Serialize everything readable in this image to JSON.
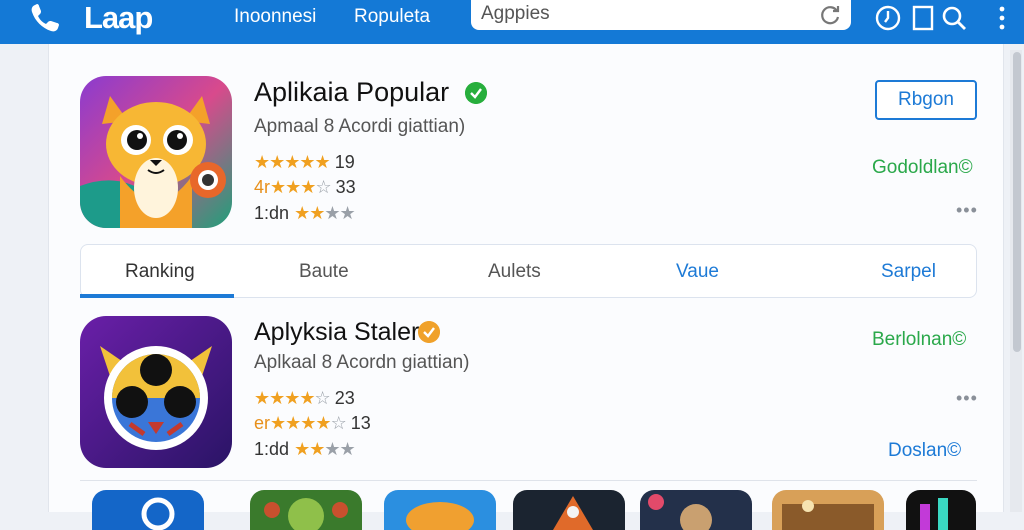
{
  "header": {
    "logo": "Laap",
    "nav": [
      "Inoonnesi",
      "Ropuleta"
    ],
    "search_value": "Agppies",
    "icons": [
      "phone-icon",
      "refresh-icon",
      "clock-icon",
      "square-icon",
      "search-icon",
      "more-vertical-icon"
    ]
  },
  "apps": [
    {
      "title": "Aplikaia Popular",
      "subtitle": "Apmaal 8 Acordi giattian)",
      "ratings": [
        {
          "prefix": "",
          "count": "19",
          "stars": 5
        },
        {
          "prefix": "4r",
          "count": "33",
          "stars": 4
        },
        {
          "prefix": "1:dn",
          "count": "",
          "stars": 3
        }
      ],
      "button": "Rbgon",
      "link": "Godoldlan©",
      "badge_color": "#27ae3c"
    },
    {
      "title": "Aplyksia Staler",
      "subtitle": "Aplkaal 8 Acordn giattian)",
      "ratings": [
        {
          "prefix": "",
          "count": "23",
          "stars": 4
        },
        {
          "prefix": "er",
          "count": "13",
          "stars": 4
        },
        {
          "prefix": "1:dd",
          "count": "",
          "stars": 3
        }
      ],
      "link_top": "Berlolnan©",
      "link_bottom": "Doslan©",
      "badge_color": "#f0a12a"
    }
  ],
  "tabs": [
    "Ranking",
    "Baute",
    "Aulets",
    "Vaue",
    "Sarpel"
  ],
  "colors": {
    "header": "#1479d6",
    "accent": "#1d7ad6",
    "green": "#2aa84a"
  }
}
